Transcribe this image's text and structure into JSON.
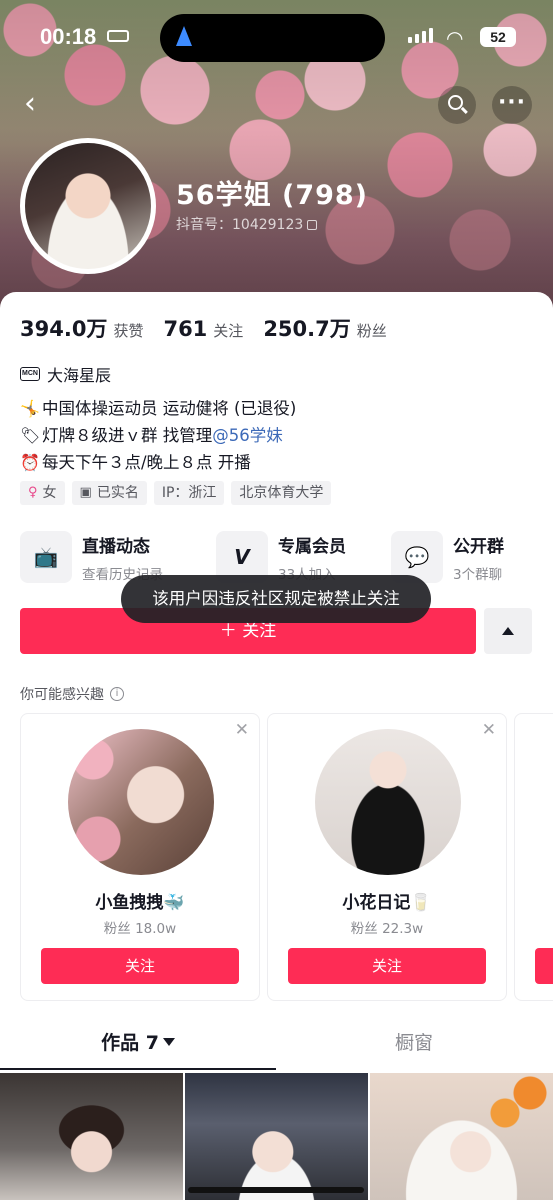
{
  "status_bar": {
    "time": "00:18",
    "battery": "52"
  },
  "profile": {
    "nickname": "56学姐 (798)",
    "douyin_id": "抖音号：10429123",
    "stats": [
      {
        "value": "394.0万",
        "label": "获赞"
      },
      {
        "value": "761",
        "label": "关注"
      },
      {
        "value": "250.7万",
        "label": "粉丝"
      }
    ],
    "mcn_icon": "MCN",
    "mcn_name": "大海星辰",
    "bio": {
      "line1_emoji": "🤸",
      "line1": "中国体操运动员 运动健将 (已退役)",
      "line2_emoji": "🏷",
      "line2": "灯牌８级进ｖ群 找管理 ",
      "line2_link": "@56学妹",
      "line3_emoji": "⏰",
      "line3": "每天下午３点/晚上８点 开播"
    },
    "tags": [
      {
        "icon": "♀",
        "text": "女"
      },
      {
        "icon": "▣",
        "text": "已实名"
      },
      {
        "icon": "",
        "text": "IP：浙江"
      },
      {
        "icon": "",
        "text": "北京体育大学"
      }
    ]
  },
  "shortcuts": [
    {
      "title": "直播动态",
      "sub": "查看历史记录",
      "icon": "tv-icon"
    },
    {
      "title": "专属会员",
      "sub": "33人加入",
      "icon": "v-icon"
    },
    {
      "title": "公开群",
      "sub": "3个群聊",
      "icon": "chat-icon"
    }
  ],
  "follow_button": "＋ 关注",
  "toast": "该用户因违反社区规定被禁止关注",
  "recommend": {
    "title": "你可能感兴趣",
    "cards": [
      {
        "name": "小鱼拽拽🐳",
        "fans": "粉丝 18.0w",
        "button": "关注"
      },
      {
        "name": "小花日记🥛",
        "fans": "粉丝 22.3w",
        "button": "关注"
      }
    ]
  },
  "tabs": [
    {
      "label": "作品 7",
      "active": true
    },
    {
      "label": "橱窗",
      "active": false
    }
  ],
  "colors": {
    "brand": "#fe2c55",
    "link": "#3d6ab8",
    "text": "#161823",
    "muted": "#8a8b91"
  }
}
